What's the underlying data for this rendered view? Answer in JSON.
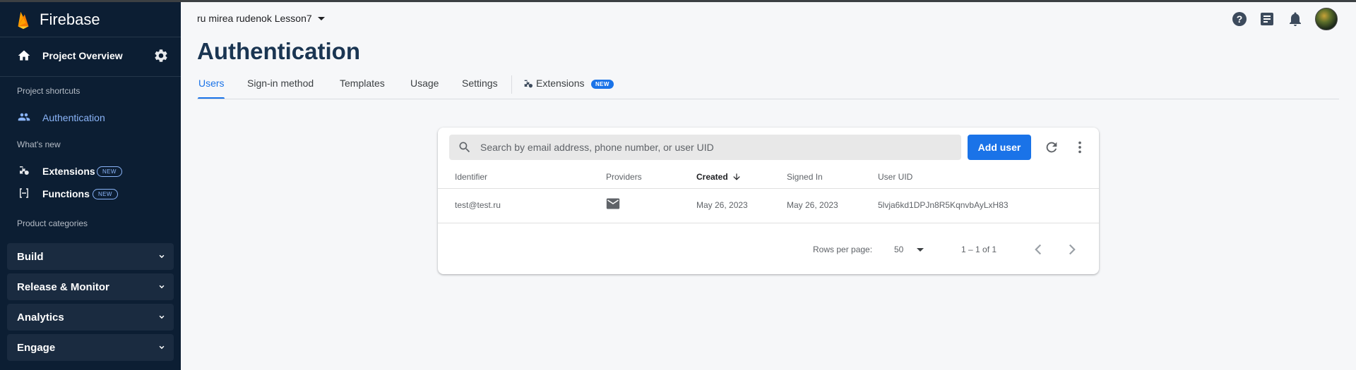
{
  "sidebar": {
    "brand": "Firebase",
    "project_overview": "Project Overview",
    "shortcuts_title": "Project shortcuts",
    "authentication": "Authentication",
    "whats_new_title": "What's new",
    "extensions": "Extensions",
    "functions": "Functions",
    "new_badge": "NEW",
    "categories_title": "Product categories",
    "categories": [
      "Build",
      "Release & Monitor",
      "Analytics",
      "Engage"
    ]
  },
  "header": {
    "project_name": "ru mirea rudenok Lesson7",
    "page_title": "Authentication"
  },
  "tabs": {
    "users": "Users",
    "signin": "Sign-in method",
    "templates": "Templates",
    "usage": "Usage",
    "settings": "Settings",
    "extensions": "Extensions",
    "extensions_badge": "NEW"
  },
  "users_table": {
    "search_placeholder": "Search by email address, phone number, or user UID",
    "add_user_label": "Add user",
    "columns": [
      "Identifier",
      "Providers",
      "Created",
      "Signed In",
      "User UID"
    ],
    "rows": [
      {
        "identifier": "test@test.ru",
        "provider_icon": "email-icon",
        "created": "May 26, 2023",
        "signed_in": "May 26, 2023",
        "uid": "5lvja6kd1DPJn8R5KqnvbAyLxH83"
      }
    ],
    "rows_per_page_label": "Rows per page:",
    "rows_per_page_value": "50",
    "range_text": "1 – 1 of 1"
  },
  "colors": {
    "sidebar_bg": "#0c1e33",
    "accent": "#1a73e8",
    "active_nav": "#8ab4f8"
  }
}
